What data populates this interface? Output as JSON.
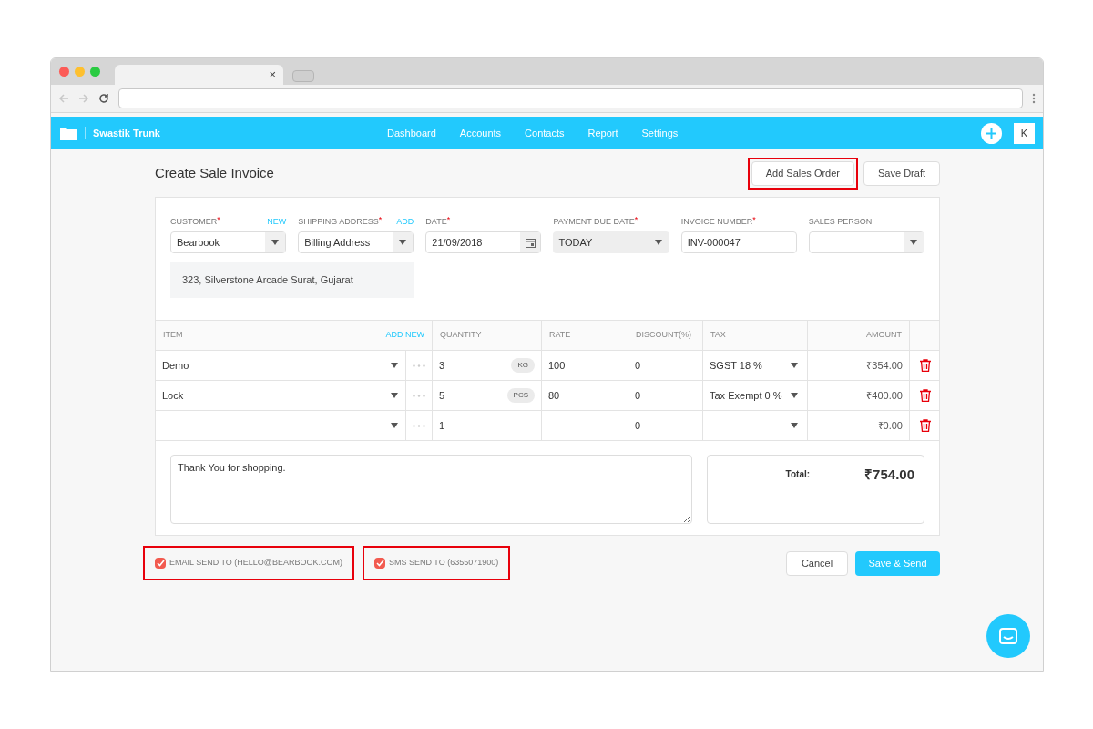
{
  "browser": {
    "tab_close": "×"
  },
  "navbar": {
    "brand": "Swastik Trunk",
    "links": [
      "Dashboard",
      "Accounts",
      "Contacts",
      "Report",
      "Settings"
    ],
    "avatar": "K"
  },
  "page": {
    "title": "Create Sale Invoice",
    "actions": [
      {
        "label": "Add Sales Order",
        "highlighted": true
      },
      {
        "label": "Save Draft",
        "highlighted": false
      }
    ]
  },
  "fields": [
    {
      "label": "CUSTOMER",
      "required_mark": "*",
      "link": "NEW",
      "kind": "select",
      "value": "Bearbook"
    },
    {
      "label": "SHIPPING ADDRESS",
      "required_mark": "*",
      "link": "ADD",
      "kind": "select",
      "value": "Billing Address"
    },
    {
      "label": "DATE",
      "required_mark": "*",
      "kind": "date",
      "value": "21/09/2018"
    },
    {
      "label": "PAYMENT DUE DATE",
      "required_mark": "*",
      "kind": "dropdown",
      "value": "TODAY"
    },
    {
      "label": "INVOICE NUMBER",
      "required_mark": "*",
      "kind": "text",
      "value": "INV-000047"
    },
    {
      "label": "SALES PERSON",
      "kind": "select"
    }
  ],
  "address": "323, Silverstone Arcade Surat, Gujarat",
  "table": {
    "columns": {
      "item": "ITEM",
      "add_new": "ADD NEW",
      "quantity": "QUANTITY",
      "rate": "RATE",
      "discount": "DISCOUNT(%)",
      "tax": "TAX",
      "amount": "AMOUNT"
    },
    "rows": [
      {
        "item": "Demo",
        "quantity": "3",
        "unit": "KG",
        "rate": "100",
        "discount": "0",
        "tax": "SGST 18 %",
        "amount": "₹354.00"
      },
      {
        "item": "Lock",
        "quantity": "5",
        "unit": "PCS",
        "rate": "80",
        "discount": "0",
        "tax": "Tax Exempt 0 %",
        "amount": "₹400.00"
      },
      {
        "quantity": "1",
        "discount": "0",
        "amount": "₹0.00"
      }
    ]
  },
  "notes": "Thank You for shopping.",
  "total": {
    "label": "Total:",
    "value": "₹754.00"
  },
  "send_options": [
    {
      "label": "EMAIL SEND TO (HELLO@BEARBOOK.COM)",
      "checked": true,
      "highlighted": true
    },
    {
      "label": "SMS SEND TO (6355071900)",
      "checked": true,
      "highlighted": true
    }
  ],
  "buttons": {
    "cancel": "Cancel",
    "submit": "Save & Send"
  }
}
